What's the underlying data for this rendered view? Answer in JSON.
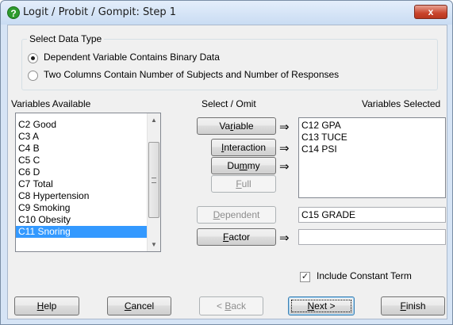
{
  "window": {
    "title": "Logit / Probit / Gompit: Step 1",
    "title_icon": "help-question-icon",
    "close_glyph": "x"
  },
  "data_type": {
    "legend": "Select Data Type",
    "options": [
      {
        "label": "Dependent Variable Contains Binary Data",
        "checked": true
      },
      {
        "label": "Two Columns Contain Number of Subjects and Number of Responses",
        "checked": false
      }
    ]
  },
  "available": {
    "label": "Variables Available",
    "items": [
      "C2 Good",
      "C3 A",
      "C4 B",
      "C5 C",
      "C6 D",
      "C7 Total",
      "C8 Hypertension",
      "C9 Smoking",
      "C10 Obesity",
      "C11 Snoring"
    ],
    "selected_index": 9
  },
  "select_omit_label": "Select / Omit",
  "selected": {
    "label": "Variables Selected",
    "items": [
      "C12 GPA",
      "C13 TUCE",
      "C14 PSI"
    ]
  },
  "buttons": {
    "variable": {
      "pre": "Va",
      "key": "r",
      "post": "iable"
    },
    "interaction": {
      "pre": "",
      "key": "I",
      "post": "nteraction"
    },
    "dummy": {
      "pre": "Du",
      "key": "m",
      "post": "my"
    },
    "full": {
      "pre": "",
      "key": "F",
      "post": "ull"
    },
    "dependent": {
      "pre": "",
      "key": "D",
      "post": "ependent"
    },
    "factor": {
      "pre": "",
      "key": "F",
      "post": "actor"
    },
    "help": {
      "pre": "",
      "key": "H",
      "post": "elp"
    },
    "cancel": {
      "pre": "",
      "key": "C",
      "post": "ancel"
    },
    "back": {
      "pre": "< ",
      "key": "B",
      "post": "ack"
    },
    "next": {
      "pre": "",
      "key": "N",
      "post": "ext >"
    },
    "finish": {
      "pre": "",
      "key": "F",
      "post": "inish"
    }
  },
  "arrow_glyph": "⇒",
  "dependent_value": "C15 GRADE",
  "factor_value": "",
  "include_constant": {
    "label": "Include Constant Term",
    "checked": true,
    "mark": "✓"
  }
}
